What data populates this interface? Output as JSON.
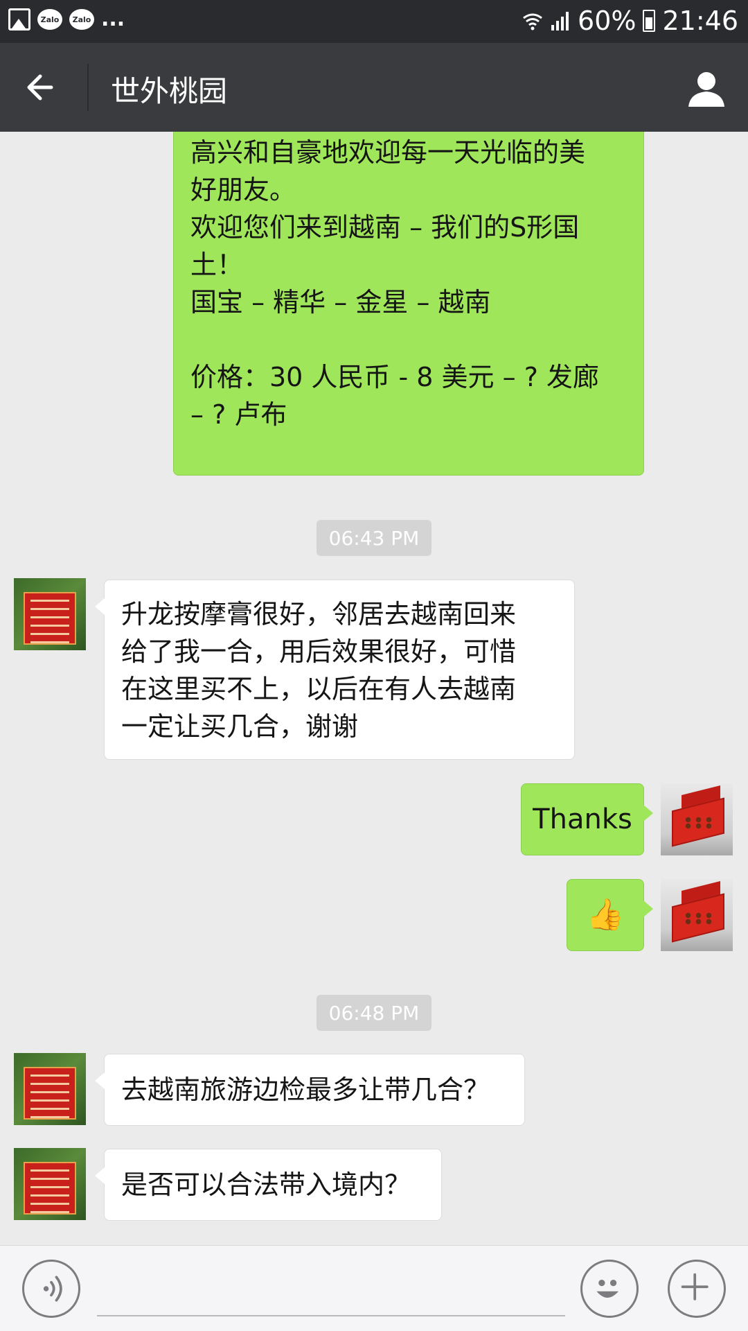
{
  "status_bar": {
    "zalo1": "Zalo",
    "zalo2": "Zalo",
    "more": "...",
    "battery": "60%",
    "time": "21:46"
  },
  "header": {
    "title": "世外桃园"
  },
  "messages": {
    "m1": "高兴和自豪地欢迎每一天光临的美\n好朋友。\n欢迎您们来到越南 – 我们的S形国\n土！\n国宝 – 精华 – 金星 – 越南\n\n价格：30 人民币 - 8 美元 – ? 发廊\n– ? 卢布",
    "ts1": "06:43 PM",
    "m2": "升龙按摩膏很好，邻居去越南回来\n给了我一合，用后效果很好，可惜\n在这里买不上，以后在有人去越南\n一定让买几合，谢谢",
    "m3": "Thanks",
    "m4": "👍",
    "ts2": "06:48 PM",
    "m5": "去越南旅游边检最多让带几合？",
    "m6": "是否可以合法带入境内？"
  },
  "icons": {
    "back": "arrow-left-icon",
    "profile": "person-icon",
    "voice": "voice-icon",
    "emoji": "smiley-icon",
    "plus": "plus-icon"
  },
  "colors": {
    "header_bg": "#3a3b3f",
    "status_bg": "#2a2b2f",
    "chat_bg": "#ebebeb",
    "outgoing_bubble": "#9fe65a",
    "incoming_bubble": "#ffffff"
  }
}
